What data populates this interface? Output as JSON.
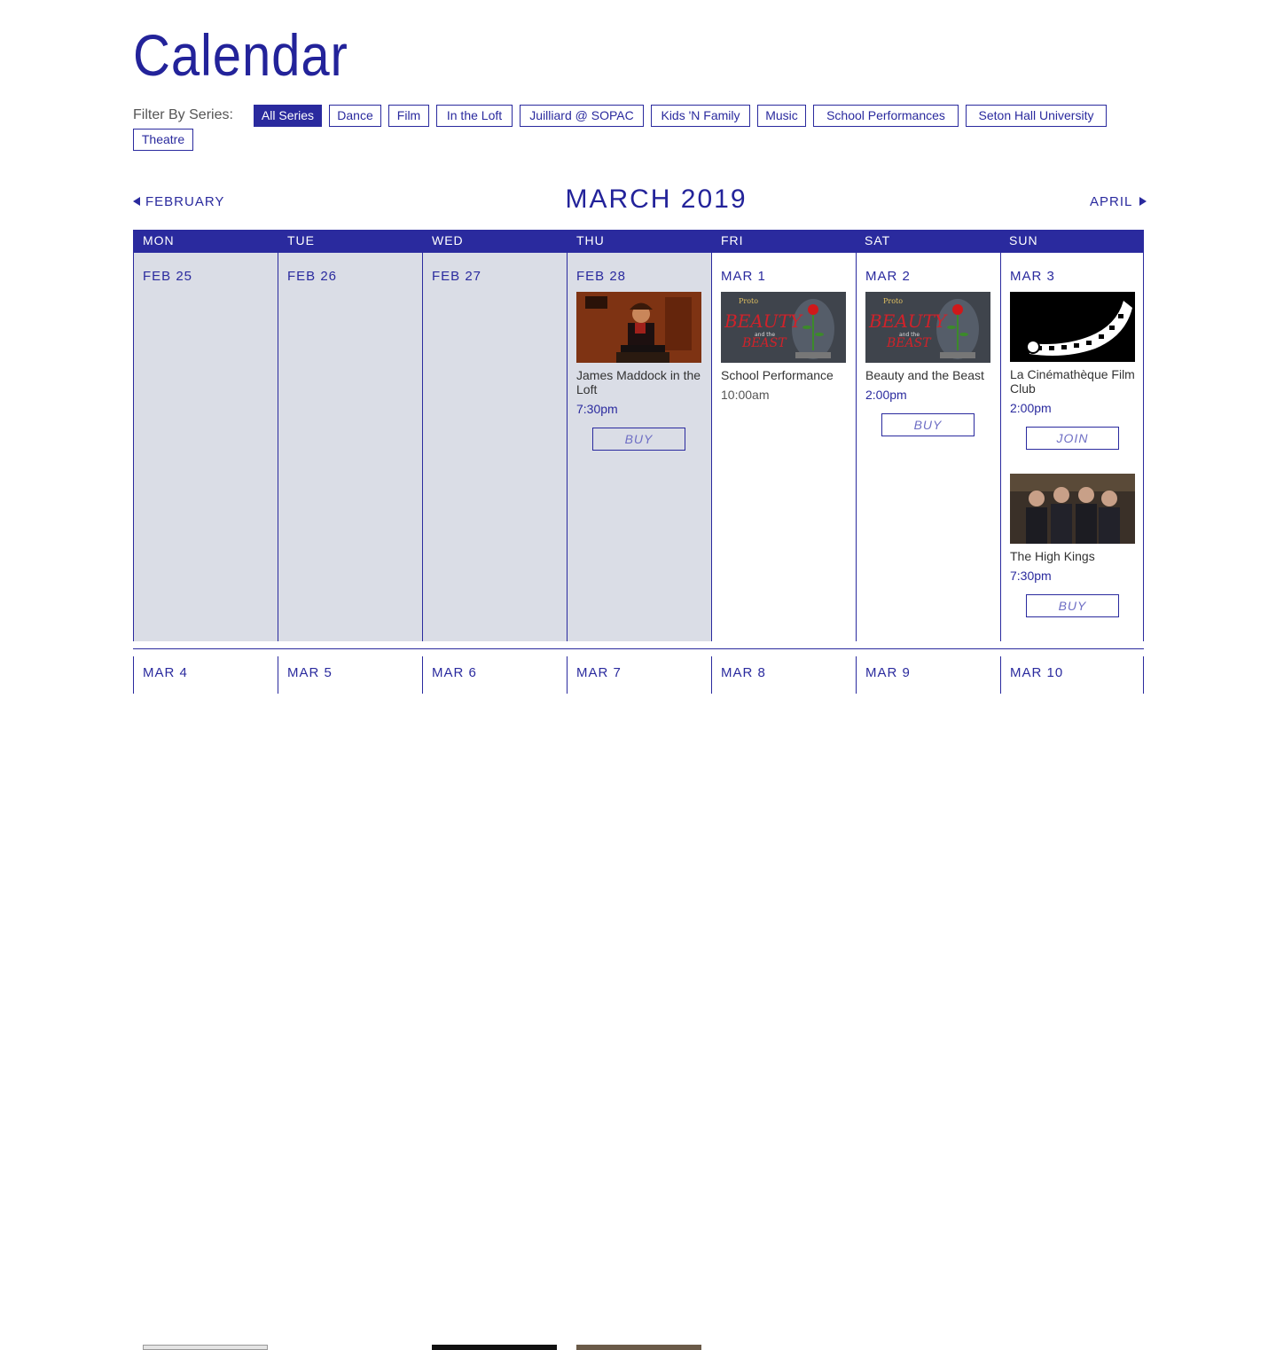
{
  "page": {
    "title": "Calendar"
  },
  "filter": {
    "label": "Filter By Series:",
    "options": [
      "All Series",
      "Dance",
      "Film",
      "In the Loft",
      "Juilliard @ SOPAC",
      "Kids 'N Family",
      "Music",
      "School Performances",
      "Seton Hall University",
      "Theatre"
    ],
    "selected": "All Series"
  },
  "nav": {
    "prev": "FEBRUARY",
    "current": "MARCH 2019",
    "next": "APRIL"
  },
  "weekdays": [
    "MON",
    "TUE",
    "WED",
    "THU",
    "FRI",
    "SAT",
    "SUN"
  ],
  "week1": [
    {
      "date": "FEB 25",
      "past": true,
      "events": []
    },
    {
      "date": "FEB 26",
      "past": true,
      "events": []
    },
    {
      "date": "FEB 27",
      "past": true,
      "events": []
    },
    {
      "date": "FEB 28",
      "past": true,
      "events": [
        {
          "title": "James Maddock in the Loft",
          "time": "7:30pm",
          "button": "BUY",
          "image": "musician-photo"
        }
      ]
    },
    {
      "date": "MAR 1",
      "past": false,
      "events": [
        {
          "title": "School Performance",
          "time": "10:00am",
          "button": null,
          "image": "beauty-and-the-beast-poster"
        }
      ]
    },
    {
      "date": "MAR 2",
      "past": false,
      "events": [
        {
          "title": "Beauty and the Beast",
          "time": "2:00pm",
          "button": "BUY",
          "image": "beauty-and-the-beast-poster"
        }
      ]
    },
    {
      "date": "MAR 3",
      "past": false,
      "events": [
        {
          "title": "La Cinémathèque Film Club",
          "time": "2:00pm",
          "button": "JOIN",
          "image": "film-reel-graphic"
        },
        {
          "title": "The High Kings",
          "time": "7:30pm",
          "button": "BUY",
          "image": "band-photo"
        }
      ]
    }
  ],
  "week2": [
    {
      "date": "MAR 4"
    },
    {
      "date": "MAR 5"
    },
    {
      "date": "MAR 6"
    },
    {
      "date": "MAR 7"
    },
    {
      "date": "MAR 8"
    },
    {
      "date": "MAR 9"
    },
    {
      "date": "MAR 10"
    }
  ],
  "poster_text": {
    "presenter": "Proto",
    "top": "BEAUTY",
    "mid": "and the",
    "bottom": "BEAST"
  },
  "colors": {
    "accent": "#2a2a9e",
    "past_bg": "#dadde6",
    "text": "#333333"
  }
}
